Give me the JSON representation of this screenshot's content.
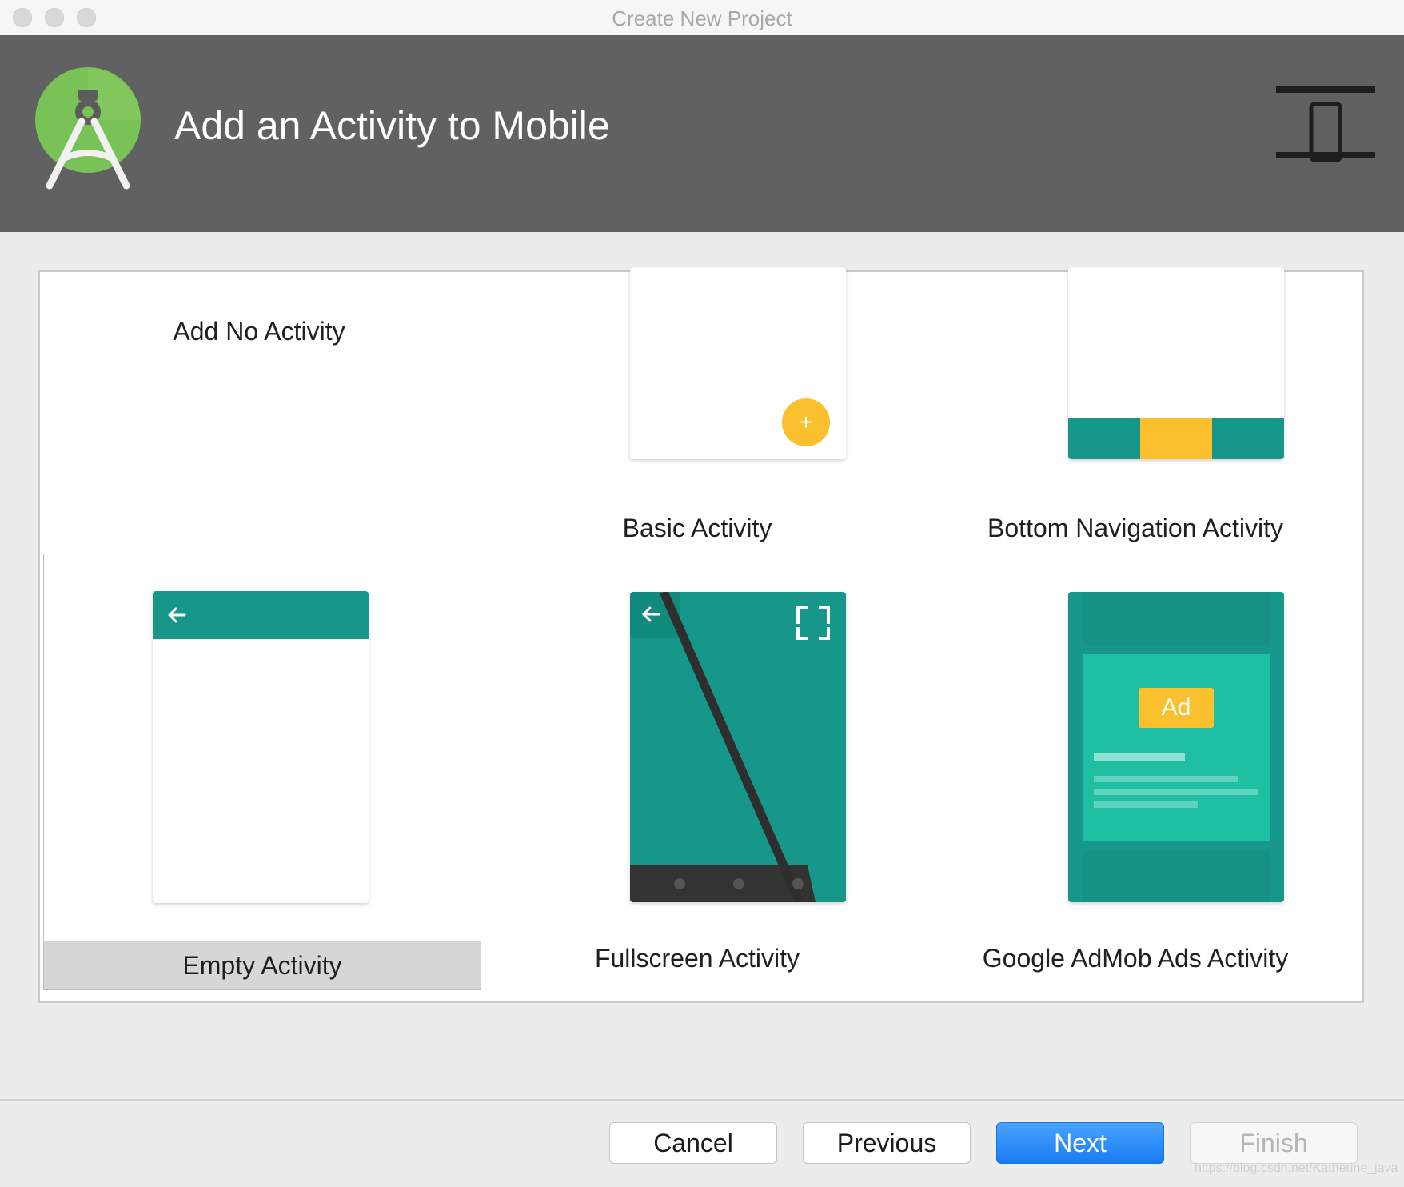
{
  "window": {
    "title": "Create New Project"
  },
  "banner": {
    "title": "Add an Activity to Mobile"
  },
  "gallery": {
    "items": [
      {
        "label": "Add No Activity"
      },
      {
        "label": "Basic Activity"
      },
      {
        "label": "Bottom Navigation Activity"
      },
      {
        "label": "Empty Activity",
        "selected": true
      },
      {
        "label": "Fullscreen Activity"
      },
      {
        "label": "Google AdMob Ads Activity"
      }
    ],
    "fab_symbol": "+",
    "ad_badge": "Ad"
  },
  "buttons": {
    "cancel": "Cancel",
    "previous": "Previous",
    "next": "Next",
    "finish": "Finish"
  },
  "watermark": "https://blog.csdn.net/Katherine_java",
  "colors": {
    "banner": "#616161",
    "teal": "#16978a",
    "teal_light": "#1fbfa3",
    "amber": "#fbc02d",
    "primary_button": "#1a7cf4"
  }
}
